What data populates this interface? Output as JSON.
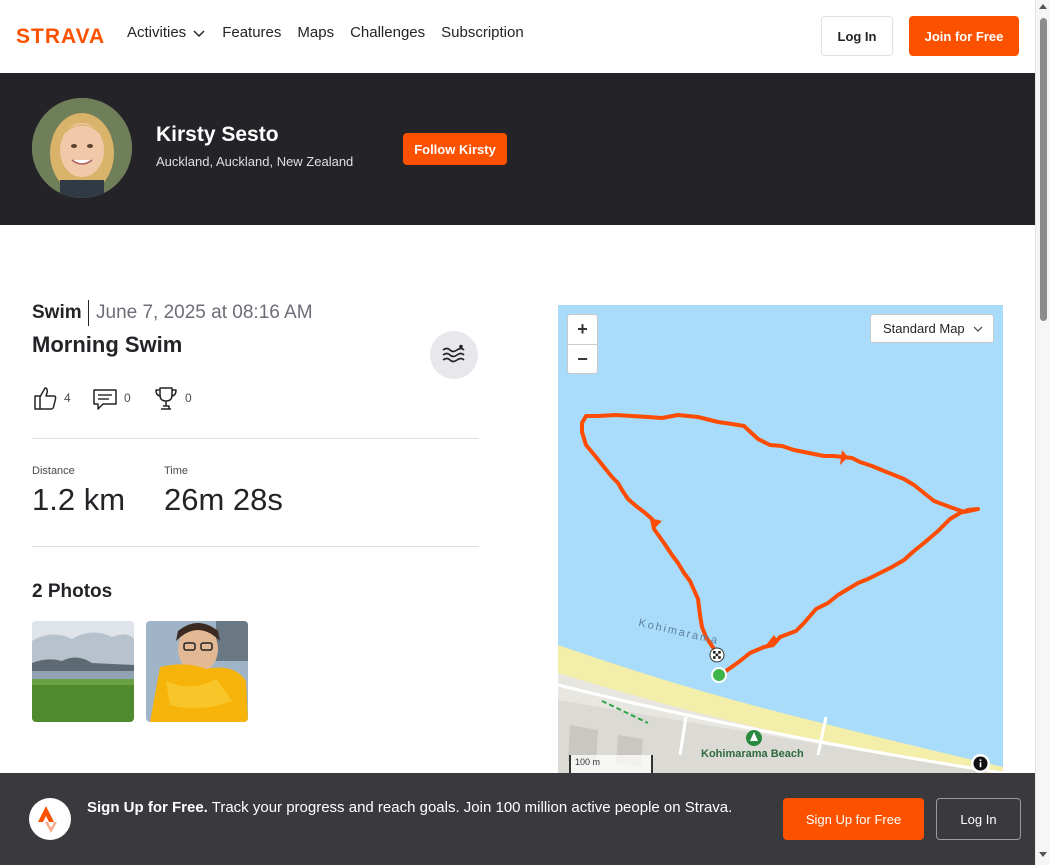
{
  "nav": {
    "brand": "STRAVA",
    "links": [
      "Activities",
      "Features",
      "Maps",
      "Challenges",
      "Subscription"
    ],
    "login": "Log In",
    "join": "Join for Free"
  },
  "athlete": {
    "name": "Kirsty Sesto",
    "location": "Auckland, Auckland, New Zealand",
    "follow": "Follow Kirsty"
  },
  "activity": {
    "type": "Swim",
    "date": "June 7, 2025 at 08:16 AM",
    "title": "Morning Swim",
    "kudos": "4",
    "comments": "0",
    "achievements": "0",
    "stats": [
      {
        "label": "Distance",
        "value": "1.2 km"
      },
      {
        "label": "Time",
        "value": "26m 28s"
      }
    ],
    "photos_heading": "2 Photos"
  },
  "map": {
    "zoom_in": "+",
    "zoom_out": "−",
    "style": "Standard Map",
    "scale": "100 m",
    "water_label": "Kohimarama",
    "beach_label": "Kohimarama Beach"
  },
  "signup": {
    "bold": "Sign Up for Free.",
    "text": " Track your progress and reach goals. Join 100 million active people on Strava.",
    "signup_btn": "Sign Up for Free",
    "login_btn": "Log In"
  },
  "colors": {
    "brand": "#fc5200",
    "dark": "#242428",
    "route": "#fc4c02",
    "water": "#a9dcfa"
  }
}
